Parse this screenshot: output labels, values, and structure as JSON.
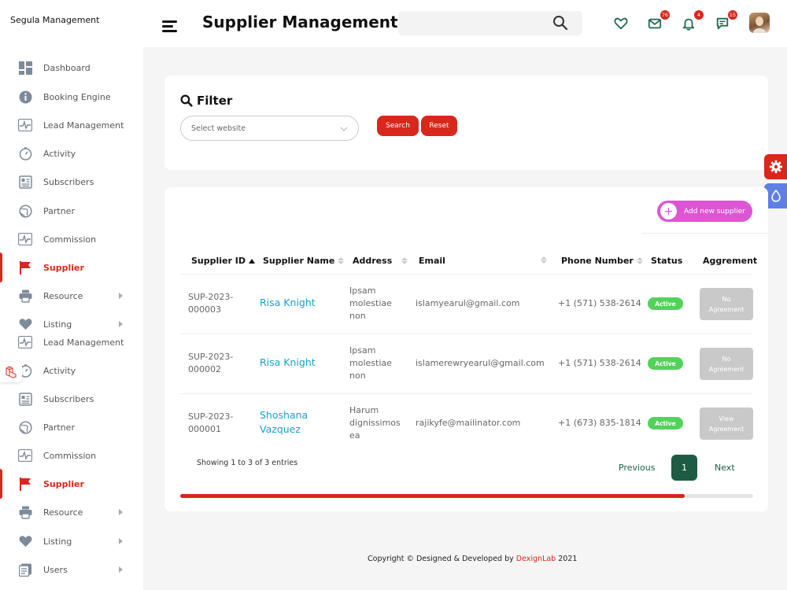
{
  "brand": "Segula Management",
  "header": {
    "title": "Supplier Management",
    "search_placeholder": "",
    "badges": {
      "mail": "76",
      "bell": "4",
      "chat": "15"
    }
  },
  "sidebar": {
    "items": [
      {
        "label": "Dashboard",
        "icon": "dashboard-icon"
      },
      {
        "label": "Booking Engine",
        "icon": "info-icon"
      },
      {
        "label": "Lead Management",
        "icon": "pulse-icon"
      },
      {
        "label": "Activity",
        "icon": "timer-icon"
      },
      {
        "label": "Subscribers",
        "icon": "newspaper-icon"
      },
      {
        "label": "Partner",
        "icon": "globe-icon"
      },
      {
        "label": "Commission",
        "icon": "pulse-icon"
      },
      {
        "label": "Supplier",
        "icon": "flag-icon",
        "active": true
      },
      {
        "label": "Resource",
        "icon": "printer-icon",
        "has_submenu": true
      },
      {
        "label": "Listing",
        "icon": "heart-icon",
        "has_submenu": true
      },
      {
        "label": "Lead Management",
        "icon": "pulse-icon"
      },
      {
        "label": "Activity",
        "icon": "timer-icon"
      },
      {
        "label": "Subscribers",
        "icon": "newspaper-icon"
      },
      {
        "label": "Partner",
        "icon": "globe-icon"
      },
      {
        "label": "Commission",
        "icon": "pulse-icon"
      },
      {
        "label": "Supplier",
        "icon": "flag-icon",
        "active": true
      },
      {
        "label": "Resource",
        "icon": "printer-icon",
        "has_submenu": true
      },
      {
        "label": "Listing",
        "icon": "heart-icon",
        "has_submenu": true
      },
      {
        "label": "Users",
        "icon": "document-icon",
        "has_submenu": true
      }
    ]
  },
  "filter": {
    "title": "Filter",
    "select_placeholder": "Select website",
    "search_label": "Search",
    "reset_label": "Reset"
  },
  "table": {
    "add_label": "Add new supplier",
    "columns": [
      "Supplier ID",
      "Supplier Name",
      "Address",
      "Email",
      "Phone Number",
      "Status",
      "Aggrement"
    ],
    "rows": [
      {
        "id1": "SUP-2023-",
        "id2": "000003",
        "name1": "Risa Knight",
        "name2": "",
        "addr1": "Ipsam",
        "addr2": "molestiae",
        "addr3": "non",
        "email": "islamyearul@gmail.com",
        "phone": "+1 (571) 538-2614",
        "status": "Active",
        "agr1": "No",
        "agr2": "Agreement"
      },
      {
        "id1": "SUP-2023-",
        "id2": "000002",
        "name1": "Risa Knight",
        "name2": "",
        "addr1": "Ipsam",
        "addr2": "molestiae",
        "addr3": "non",
        "email": "islamerewryearul@gmail.com",
        "phone": "+1 (571) 538-2614",
        "status": "Active",
        "agr1": "No",
        "agr2": "Agreement"
      },
      {
        "id1": "SUP-2023-",
        "id2": "000001",
        "name1": "Shoshana",
        "name2": "Vazquez",
        "addr1": "Harum",
        "addr2": "dignissimos",
        "addr3": "ea",
        "email": "rajikyfe@mailinator.com",
        "phone": "+1 (673) 835-1814",
        "status": "Active",
        "agr1": "View",
        "agr2": "Agreement"
      }
    ],
    "info": "Showing 1 to 3 of 3 entries",
    "prev": "Previous",
    "page": "1",
    "next": "Next",
    "scroll_fraction": 0.88
  },
  "footer": {
    "prefix": "Copyright © Designed & Developed by ",
    "brand": "DexignLab",
    "suffix": " 2021"
  },
  "colors": {
    "accent": "#d8271c",
    "link": "#1aa0c8",
    "status": "#53d25b",
    "add": "#dd55d2",
    "pager": "#1d5c42"
  }
}
